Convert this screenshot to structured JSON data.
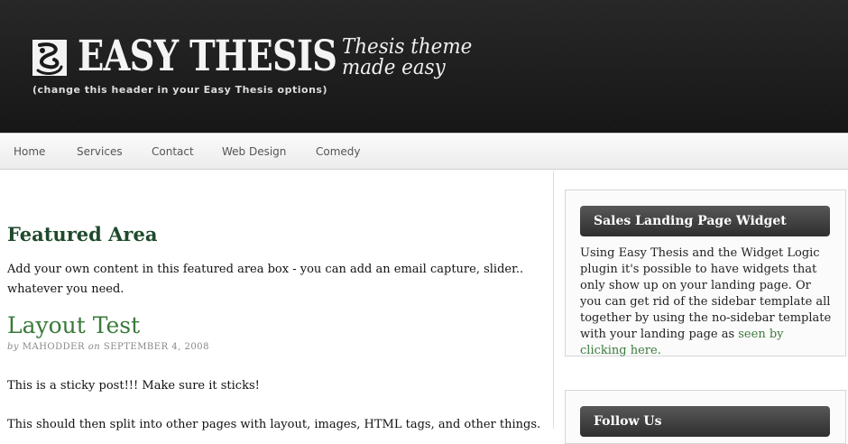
{
  "header": {
    "logo_icon": "ornamental-logo-icon",
    "title": "EASY THESIS",
    "tagline_line1": "Thesis theme",
    "tagline_line2": "made easy",
    "note": "(change this header in your Easy Thesis options)"
  },
  "nav": {
    "items": [
      "Home",
      "Services",
      "Contact",
      "Web Design",
      "Comedy"
    ]
  },
  "content": {
    "featured_heading": "Featured Area",
    "featured_text": "Add your own content in this featured area box - you can add an email capture, slider.. whatever you need.",
    "post_title": "Layout Test",
    "byline_by": "by",
    "author": "MAHODDER",
    "byline_on": "on",
    "date": "SEPTEMBER 4, 2008",
    "para1": "This is a sticky post!!! Make sure it sticks!",
    "para2": "This should then split into other pages with layout, images, HTML tags, and other things."
  },
  "sidebar": {
    "widget1_title": "Sales Landing Page Widget",
    "widget1_text": "Using Easy Thesis and the Widget Logic plugin it's possible to have widgets that only show up on your landing page. Or you can get rid of the sidebar template all together by using the no-sidebar template with your landing page as ",
    "widget1_link": "seen by clicking here.",
    "widget2_title": "Follow Us"
  },
  "colors": {
    "accent_green": "#3a7a3a",
    "heading_green": "#1f4a2c",
    "header_bg": "#1c1c1c"
  }
}
